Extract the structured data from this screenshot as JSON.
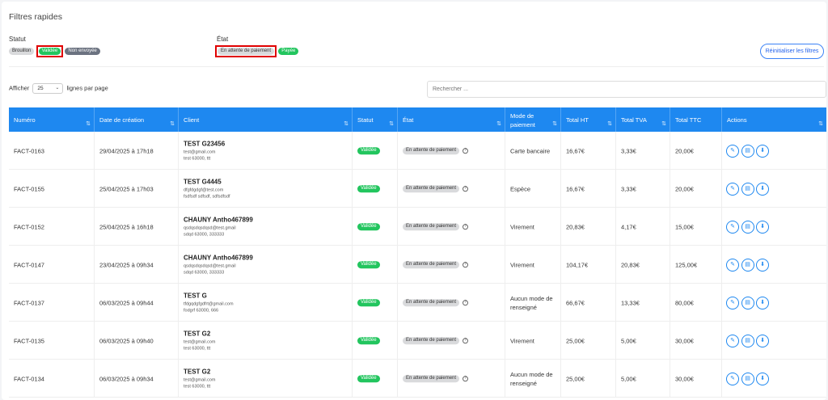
{
  "filters": {
    "title": "Filtres rapides",
    "statut_label": "Statut",
    "etat_label": "État",
    "statut_chips": [
      "Brouillon",
      "Validée",
      "Non envoyée"
    ],
    "etat_chips": [
      "En attente de paiement",
      "Payée"
    ],
    "reset_label": "Réinitialiser les filtres"
  },
  "pagination": {
    "prefix": "Afficher",
    "value": "25",
    "suffix": "lignes par page"
  },
  "search": {
    "placeholder": "Rechercher ..."
  },
  "columns": {
    "numero": "Numéro",
    "date": "Date de création",
    "client": "Client",
    "statut": "Statut",
    "etat": "État",
    "mode_l1": "Mode de",
    "mode_l2": "paiement",
    "ht": "Total HT",
    "tva": "Total TVA",
    "ttc": "Total TTC",
    "actions": "Actions"
  },
  "sort_icon": "⇅",
  "rows": [
    {
      "numero": "FACT-0163",
      "date": "29/04/2025 à 17h18",
      "client": "TEST G23456",
      "line1": "test@gmail.com",
      "line2": "test 63000, ttt",
      "statut": "Validée",
      "etat": "En attente de paiement",
      "mode1": "Carte bancaire",
      "mode2": "",
      "ht": "16,67€",
      "tva": "3,33€",
      "ttc": "20,00€"
    },
    {
      "numero": "FACT-0155",
      "date": "25/04/2025 à 17h03",
      "client": "TEST G4445",
      "line1": "dfgfdgdgf@test.com",
      "line2": "fsdfsdf sdfsdf, sdfsdfsdf",
      "statut": "Validée",
      "etat": "En attente de paiement",
      "mode1": "Espèce",
      "mode2": "",
      "ht": "16,67€",
      "tva": "3,33€",
      "ttc": "20,00€"
    },
    {
      "numero": "FACT-0152",
      "date": "25/04/2025 à 16h18",
      "client": "CHAUNY Antho467899",
      "line1": "qsdqsdqsdqsd@test.gmail",
      "line2": "sdqd 63000, 333333",
      "statut": "Validée",
      "etat": "En attente de paiement",
      "mode1": "Virement",
      "mode2": "",
      "ht": "20,83€",
      "tva": "4,17€",
      "ttc": "15,00€"
    },
    {
      "numero": "FACT-0147",
      "date": "23/04/2025 à 09h34",
      "client": "CHAUNY Antho467899",
      "line1": "qsdqsdqsdqsd@test.gmail",
      "line2": "sdqd 63000, 333333",
      "statut": "Validée",
      "etat": "En attente de paiement",
      "mode1": "Virement",
      "mode2": "",
      "ht": "104,17€",
      "tva": "20,83€",
      "ttc": "125,00€"
    },
    {
      "numero": "FACT-0137",
      "date": "06/03/2025 à 09h44",
      "client": "TEST G",
      "line1": "tfdgqdgfgdfrt@gmail.com",
      "line2": "fodgrf 63000, 666",
      "statut": "Validée",
      "etat": "En attente de paiement",
      "mode1": "Aucun mode de",
      "mode2": "renseigné",
      "ht": "66,67€",
      "tva": "13,33€",
      "ttc": "80,00€"
    },
    {
      "numero": "FACT-0135",
      "date": "06/03/2025 à 09h40",
      "client": "TEST G2",
      "line1": "test@gmail.com",
      "line2": "test 63000, ttt",
      "statut": "Validée",
      "etat": "En attente de paiement",
      "mode1": "Virement",
      "mode2": "",
      "ht": "25,00€",
      "tva": "5,00€",
      "ttc": "30,00€"
    },
    {
      "numero": "FACT-0134",
      "date": "06/03/2025 à 09h34",
      "client": "TEST G2",
      "line1": "test@gmail.com",
      "line2": "test 63000, ttt",
      "statut": "Validée",
      "etat": "En attente de paiement",
      "mode1": "Aucun mode de",
      "mode2": "renseigné",
      "ht": "25,00€",
      "tva": "5,00€",
      "ttc": "30,00€"
    }
  ],
  "action_icons": [
    "edit-icon",
    "document-icon",
    "download-icon"
  ],
  "colors": {
    "primary": "#1e88f0",
    "validee": "#22c55e",
    "selected_outline": "#e00000"
  }
}
